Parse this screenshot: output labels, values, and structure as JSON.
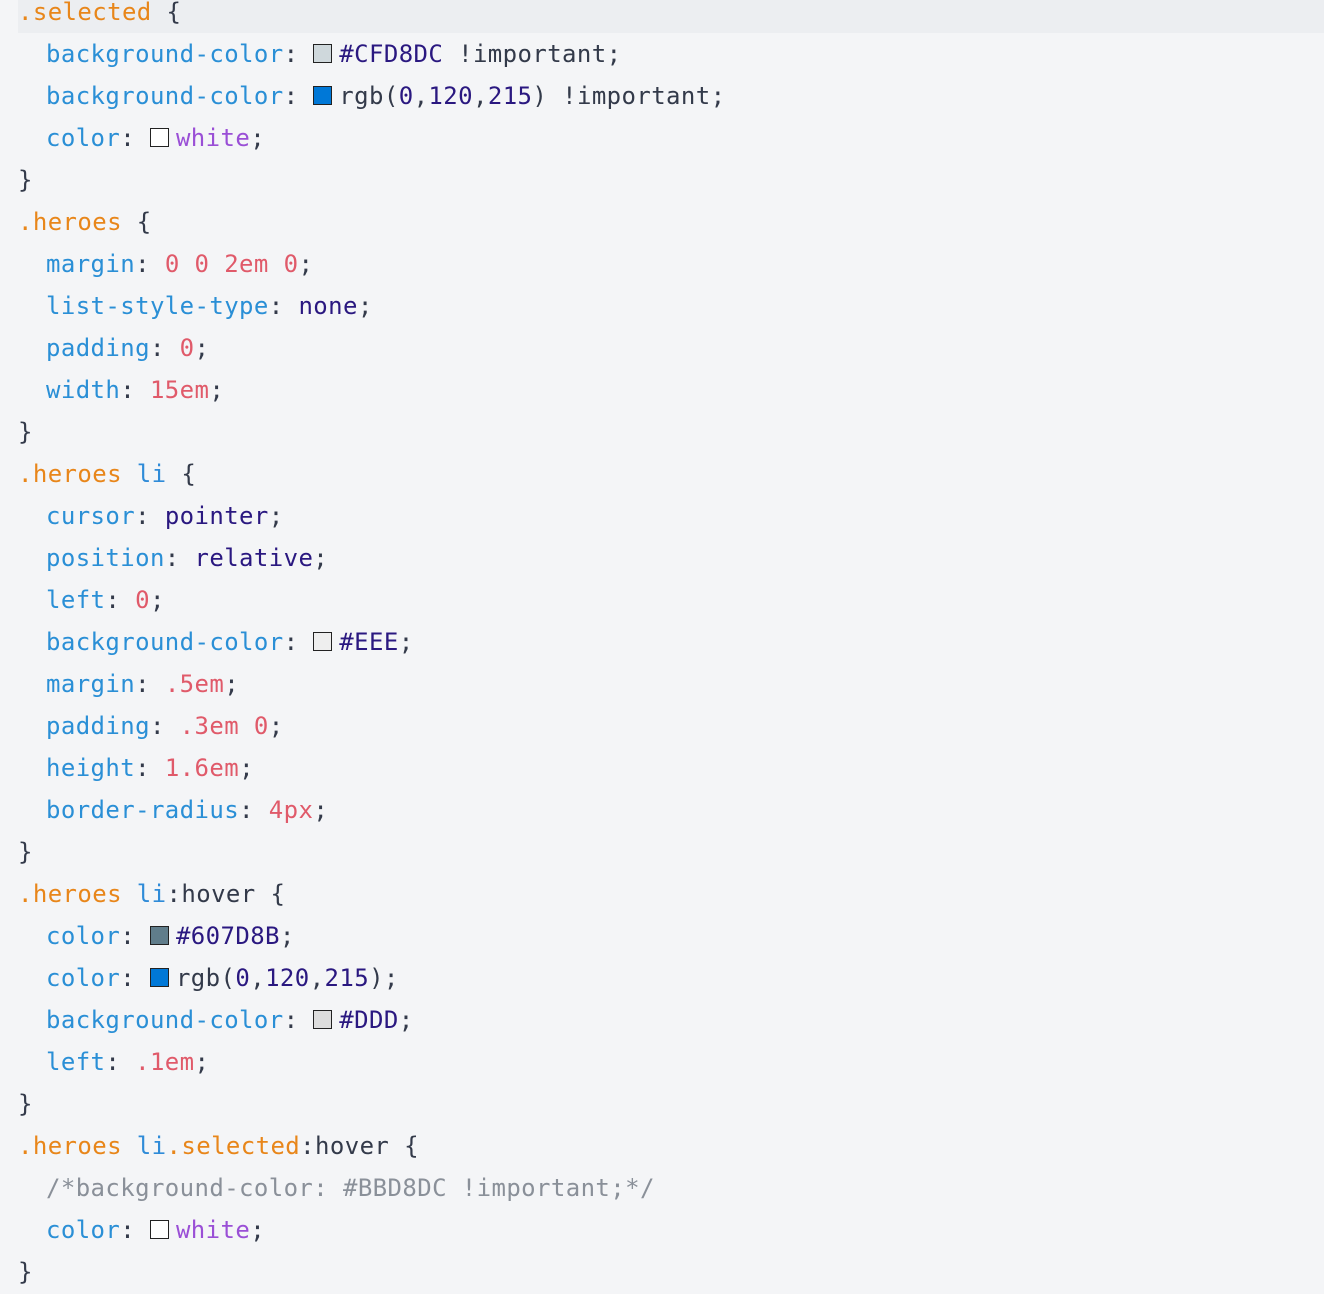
{
  "rules": [
    {
      "selector_parts": [
        {
          "text": ".selected",
          "kind": "sel"
        }
      ],
      "decls": [
        {
          "prop": "background-color",
          "swatch": "#CFD8DC",
          "value": "#CFD8DC",
          "suffix": " !important",
          "kind": "hex"
        },
        {
          "prop": "background-color",
          "swatch": "#0078D7",
          "value": "rgb(0,120,215)",
          "suffix": " !important",
          "kind": "text"
        },
        {
          "prop": "color",
          "swatch": "#FFFFFF",
          "value": "white",
          "suffix": "",
          "kind": "named"
        }
      ]
    },
    {
      "selector_parts": [
        {
          "text": ".heroes",
          "kind": "sel"
        }
      ],
      "decls": [
        {
          "prop": "margin",
          "value": "0 0 2em 0",
          "kind": "num"
        },
        {
          "prop": "list-style-type",
          "value": "none",
          "kind": "kw"
        },
        {
          "prop": "padding",
          "value": "0",
          "kind": "num"
        },
        {
          "prop": "width",
          "value": "15em",
          "kind": "num"
        }
      ]
    },
    {
      "selector_parts": [
        {
          "text": ".heroes",
          "kind": "sel"
        },
        {
          "text": " li",
          "kind": "tag"
        }
      ],
      "decls": [
        {
          "prop": "cursor",
          "value": "pointer",
          "kind": "kw"
        },
        {
          "prop": "position",
          "value": "relative",
          "kind": "kw"
        },
        {
          "prop": "left",
          "value": "0",
          "kind": "num"
        },
        {
          "prop": "background-color",
          "swatch": "#EEEEEE",
          "value": "#EEE",
          "kind": "hex"
        },
        {
          "prop": "margin",
          "value": ".5em",
          "kind": "num"
        },
        {
          "prop": "padding",
          "value": ".3em 0",
          "kind": "num"
        },
        {
          "prop": "height",
          "value": "1.6em",
          "kind": "num"
        },
        {
          "prop": "border-radius",
          "value": "4px",
          "kind": "num"
        }
      ]
    },
    {
      "selector_parts": [
        {
          "text": ".heroes",
          "kind": "sel"
        },
        {
          "text": " li",
          "kind": "tag"
        },
        {
          "text": ":hover",
          "kind": "pseudo"
        }
      ],
      "decls": [
        {
          "prop": "color",
          "swatch": "#607D8B",
          "value": "#607D8B",
          "kind": "hex"
        },
        {
          "prop": "color",
          "swatch": "#0078D7",
          "value": "rgb(0,120,215)",
          "kind": "text"
        },
        {
          "prop": "background-color",
          "swatch": "#DDDDDD",
          "value": "#DDD",
          "kind": "hex"
        },
        {
          "prop": "left",
          "value": ".1em",
          "kind": "num"
        }
      ]
    },
    {
      "selector_parts": [
        {
          "text": ".heroes",
          "kind": "sel"
        },
        {
          "text": " li",
          "kind": "tag"
        },
        {
          "text": ".selected",
          "kind": "sel"
        },
        {
          "text": ":hover",
          "kind": "pseudo"
        }
      ],
      "decls": [
        {
          "comment": "/*background-color: #BBD8DC !important;*/"
        },
        {
          "prop": "color",
          "swatch": "#FFFFFF",
          "value": "white",
          "suffix": "",
          "kind": "named"
        }
      ]
    }
  ]
}
